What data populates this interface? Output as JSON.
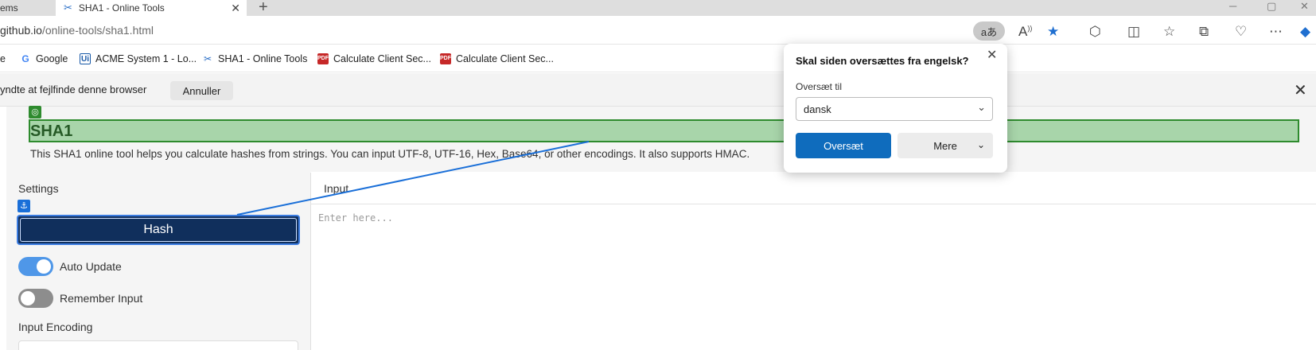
{
  "browser": {
    "tabs": [
      {
        "label": "ems",
        "active": false
      },
      {
        "label": "SHA1 - Online Tools",
        "active": true,
        "close": "✕"
      }
    ],
    "url_host": "github.io",
    "url_path": "/online-tools/sha1.html",
    "translate_pill": "aあ",
    "bookmarks": [
      {
        "label": "e",
        "icon": "none"
      },
      {
        "label": "Google",
        "icon": "google-icon"
      },
      {
        "label": "ACME System 1 - Lo...",
        "icon": "ui-icon"
      },
      {
        "label": "SHA1 - Online Tools",
        "icon": "tools-icon"
      },
      {
        "label": "Calculate Client Sec...",
        "icon": "pdf-icon"
      },
      {
        "label": "Calculate Client Sec...",
        "icon": "pdf-icon"
      }
    ],
    "infobar": {
      "text": "yndte at fejlfinde denne browser",
      "cancel": "Annuller"
    }
  },
  "page": {
    "title": "SHA1",
    "description": "This SHA1 online tool helps you calculate hashes from strings. You can input UTF-8, UTF-16, Hex, Base64, or other encodings. It also supports HMAC.",
    "settings_label": "Settings",
    "input_label": "Input",
    "hash_button": "Hash",
    "auto_update_label": "Auto Update",
    "auto_update_on": true,
    "remember_input_label": "Remember Input",
    "remember_input_on": false,
    "input_encoding_label": "Input Encoding",
    "input_placeholder": "Enter here..."
  },
  "translate_popup": {
    "title": "Skal siden oversættes fra engelsk?",
    "to_label": "Oversæt til",
    "language": "dansk",
    "translate_button": "Oversæt",
    "more_button": "Mere"
  },
  "colors": {
    "highlight_green": "#4caf50",
    "hash_button_bg": "#102f5c",
    "toggle_on": "#4f97e8",
    "translate_blue": "#0f6cbd"
  }
}
